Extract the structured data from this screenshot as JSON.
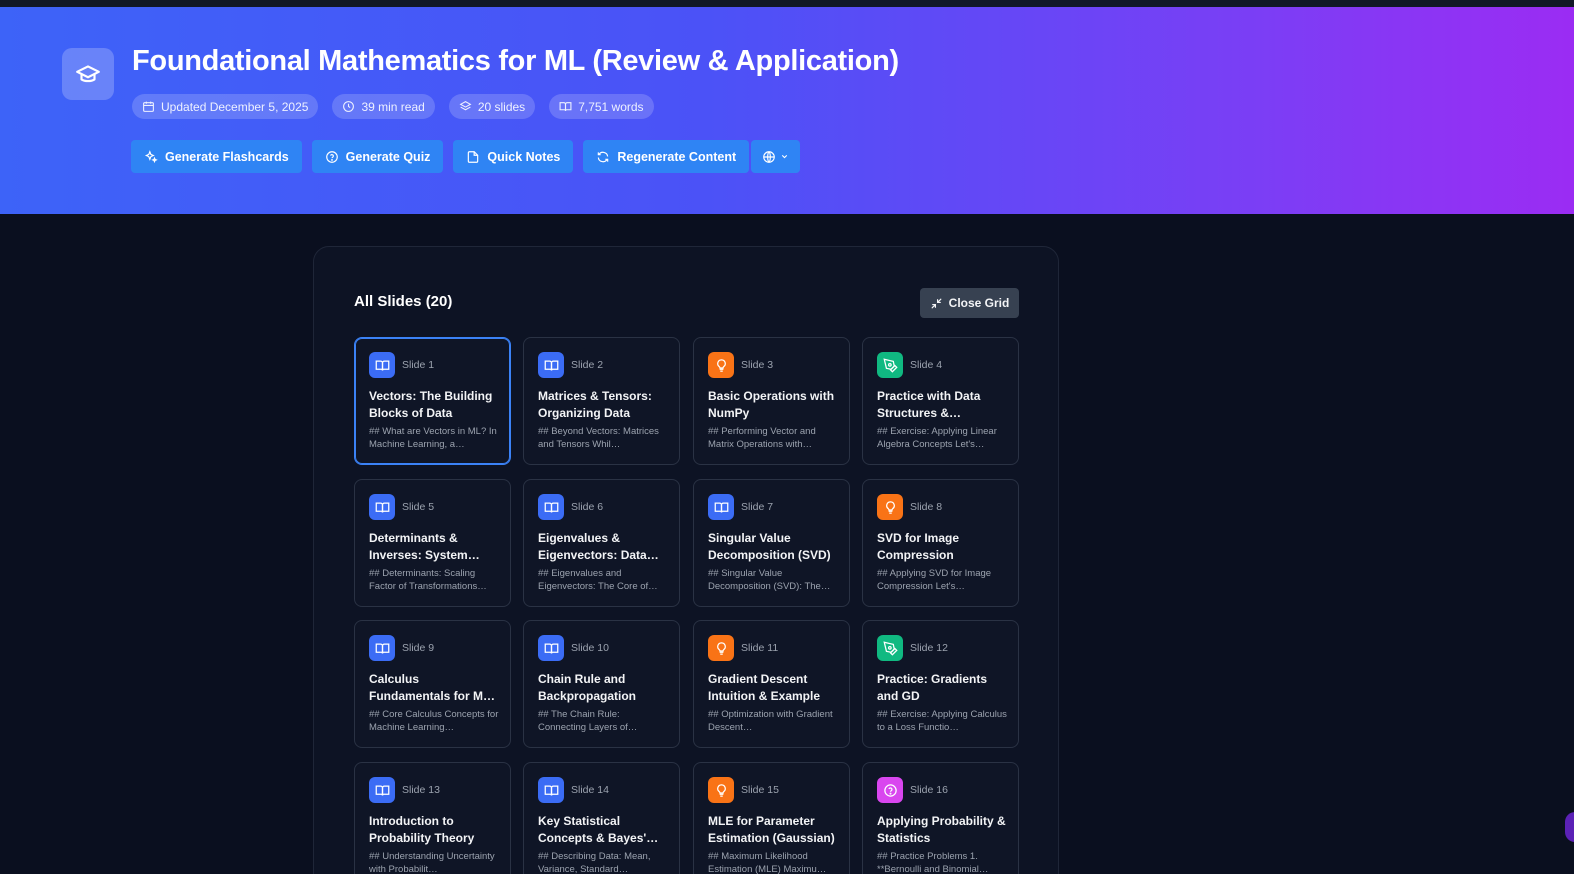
{
  "header": {
    "title": "Foundational Mathematics for ML (Review & Application)",
    "meta": {
      "updated": "Updated December 5, 2025",
      "read_time": "39 min read",
      "slides": "20 slides",
      "words": "7,751 words"
    },
    "actions": {
      "flashcards": "Generate Flashcards",
      "quiz": "Generate Quiz",
      "notes": "Quick Notes",
      "regenerate": "Regenerate Content"
    }
  },
  "grid": {
    "title": "All Slides (20)",
    "close_label": "Close Grid"
  },
  "colors": {
    "blue": "#3b6cf5",
    "orange": "#f97316",
    "green": "#10b981",
    "pink": "#d946ef"
  },
  "slides": [
    {
      "num": "Slide 1",
      "title": "Vectors: The Building Blocks of Data",
      "desc": "## What are Vectors in ML? In Machine Learning, a…",
      "icon": "book-icon",
      "color": "blue"
    },
    {
      "num": "Slide 2",
      "title": "Matrices & Tensors: Organizing Data",
      "desc": "## Beyond Vectors: Matrices and Tensors Whil…",
      "icon": "book-icon",
      "color": "blue"
    },
    {
      "num": "Slide 3",
      "title": "Basic Operations with NumPy",
      "desc": "## Performing Vector and Matrix Operations with…",
      "icon": "lightbulb-icon",
      "color": "orange"
    },
    {
      "num": "Slide 4",
      "title": "Practice with Data Structures &…",
      "desc": "## Exercise: Applying Linear Algebra Concepts Let's…",
      "icon": "pen-icon",
      "color": "green"
    },
    {
      "num": "Slide 5",
      "title": "Determinants & Inverses: System…",
      "desc": "## Determinants: Scaling Factor of Transformations…",
      "icon": "book-icon",
      "color": "blue"
    },
    {
      "num": "Slide 6",
      "title": "Eigenvalues & Eigenvectors: Data…",
      "desc": "## Eigenvalues and Eigenvectors: The Core of…",
      "icon": "book-icon",
      "color": "blue"
    },
    {
      "num": "Slide 7",
      "title": "Singular Value Decomposition (SVD)",
      "desc": "## Singular Value Decomposition (SVD): The…",
      "icon": "book-icon",
      "color": "blue"
    },
    {
      "num": "Slide 8",
      "title": "SVD for Image Compression",
      "desc": "## Applying SVD for Image Compression Let's…",
      "icon": "lightbulb-icon",
      "color": "orange"
    },
    {
      "num": "Slide 9",
      "title": "Calculus Fundamentals for ML Optimization",
      "desc": "## Core Calculus Concepts for Machine Learning…",
      "icon": "book-icon",
      "color": "blue"
    },
    {
      "num": "Slide 10",
      "title": "Chain Rule and Backpropagation",
      "desc": "## The Chain Rule: Connecting Layers of…",
      "icon": "book-icon",
      "color": "blue"
    },
    {
      "num": "Slide 11",
      "title": "Gradient Descent Intuition & Example",
      "desc": "## Optimization with Gradient Descent…",
      "icon": "lightbulb-icon",
      "color": "orange"
    },
    {
      "num": "Slide 12",
      "title": "Practice: Gradients and GD",
      "desc": "## Exercise: Applying Calculus to a Loss Functio…",
      "icon": "pen-icon",
      "color": "green"
    },
    {
      "num": "Slide 13",
      "title": "Introduction to Probability Theory",
      "desc": "## Understanding Uncertainty with Probabilit…",
      "icon": "book-icon",
      "color": "blue"
    },
    {
      "num": "Slide 14",
      "title": "Key Statistical Concepts & Bayes'…",
      "desc": "## Describing Data: Mean, Variance, Standard…",
      "icon": "book-icon",
      "color": "blue"
    },
    {
      "num": "Slide 15",
      "title": "MLE for Parameter Estimation (Gaussian)",
      "desc": "## Maximum Likelihood Estimation (MLE) Maximu…",
      "icon": "lightbulb-icon",
      "color": "orange"
    },
    {
      "num": "Slide 16",
      "title": "Applying Probability & Statistics",
      "desc": "## Practice Problems 1. **Bernoulli and Binomial…",
      "icon": "question-icon",
      "color": "pink"
    }
  ]
}
